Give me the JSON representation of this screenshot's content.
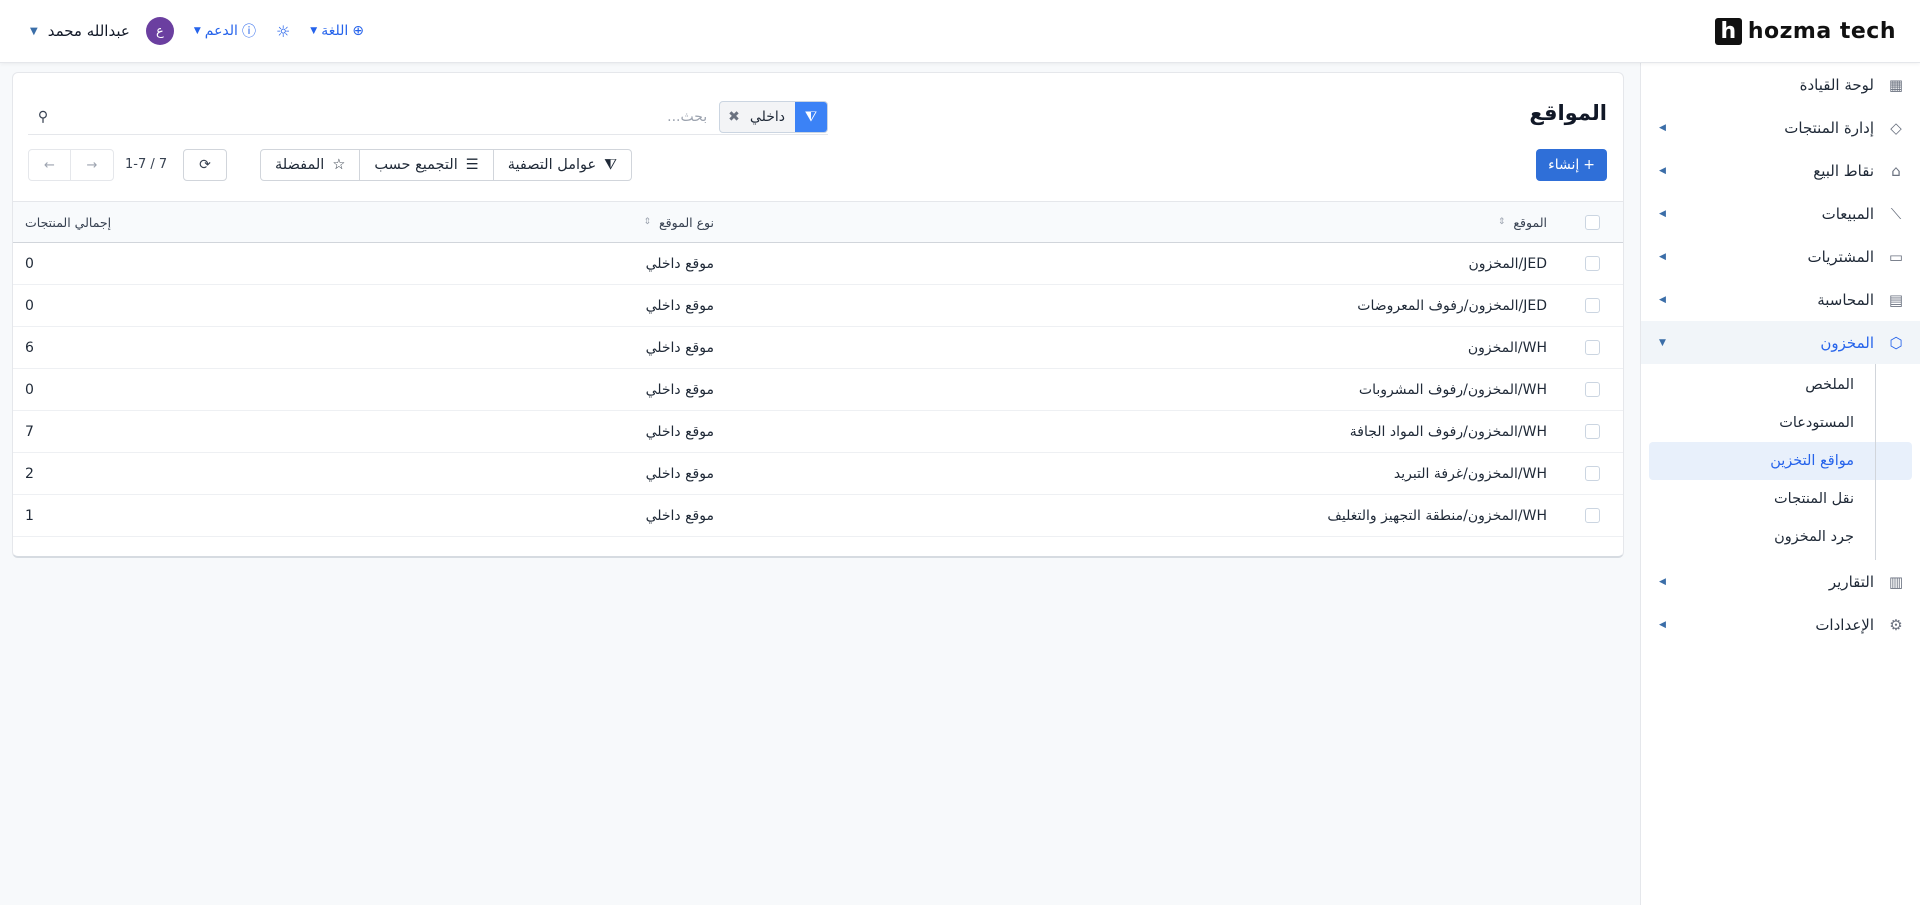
{
  "topbar": {
    "user_name": "عبدالله محمد",
    "avatar_letter": "ع",
    "support_label": "الدعم",
    "language_label": "اللغة",
    "logo_text": "hozma tech",
    "logo_mark": "h"
  },
  "sidebar": {
    "items": [
      {
        "label": "لوحة القيادة",
        "icon": "dashboard-icon",
        "has_caret": false
      },
      {
        "label": "إدارة المنتجات",
        "icon": "tag-icon",
        "has_caret": true
      },
      {
        "label": "نقاط البيع",
        "icon": "store-icon",
        "has_caret": true
      },
      {
        "label": "المبيعات",
        "icon": "chart-line-icon",
        "has_caret": true
      },
      {
        "label": "المشتريات",
        "icon": "wallet-icon",
        "has_caret": true
      },
      {
        "label": "المحاسبة",
        "icon": "calculator-icon",
        "has_caret": true
      },
      {
        "label": "المخزون",
        "icon": "box-icon",
        "has_caret": true,
        "active": true
      }
    ],
    "inventory_sub": [
      {
        "label": "الملخص"
      },
      {
        "label": "المستودعات"
      },
      {
        "label": "مواقع التخزين",
        "active": true
      },
      {
        "label": "نقل المنتجات"
      },
      {
        "label": "جرد المخزون"
      }
    ],
    "bottom_items": [
      {
        "label": "التقارير",
        "icon": "report-icon"
      },
      {
        "label": "الإعدادات",
        "icon": "gear-icon"
      }
    ]
  },
  "main": {
    "title": "المواقع",
    "search": {
      "placeholder": "بحث...",
      "filter_chip": "داخلي"
    },
    "create_label": "إنشاء",
    "toolbar": {
      "filters_label": "عوامل التصفية",
      "group_by_label": "التجميع حسب",
      "favorites_label": "المفضلة"
    },
    "pager": {
      "range": "1-7 / 7"
    }
  },
  "table": {
    "headers": {
      "location": "الموقع",
      "type": "نوع الموقع",
      "total": "إجمالي المنتجات"
    },
    "rows": [
      {
        "location": "JED/المخزون",
        "type": "موقع داخلي",
        "total": "0"
      },
      {
        "location": "JED/المخزون/رفوف المعروضات",
        "type": "موقع داخلي",
        "total": "0"
      },
      {
        "location": "WH/المخزون",
        "type": "موقع داخلي",
        "total": "6"
      },
      {
        "location": "WH/المخزون/رفوف المشروبات",
        "type": "موقع داخلي",
        "total": "0"
      },
      {
        "location": "WH/المخزون/رفوف المواد الجافة",
        "type": "موقع داخلي",
        "total": "7"
      },
      {
        "location": "WH/المخزون/غرفة التبريد",
        "type": "موقع داخلي",
        "total": "2"
      },
      {
        "location": "WH/المخزون/منطقة التجهيز والتغليف",
        "type": "موقع داخلي",
        "total": "1"
      }
    ]
  },
  "colors": {
    "accent": "#2f6fd8",
    "active_bg": "#e8f0fb",
    "avatar": "#6b3fa0"
  }
}
